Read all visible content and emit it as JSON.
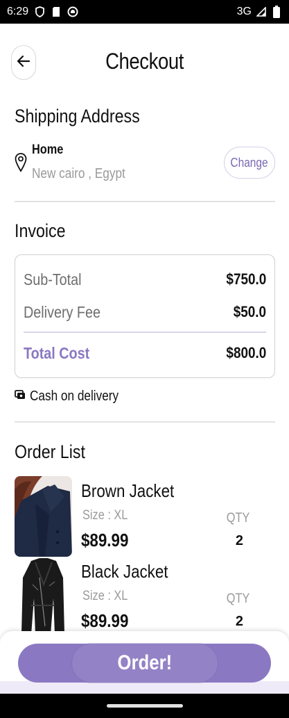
{
  "status_bar": {
    "time": "6:29",
    "network": "3G"
  },
  "header": {
    "title": "Checkout"
  },
  "shipping": {
    "section_title": "Shipping Address",
    "name": "Home",
    "address": "New cairo , Egypt",
    "change_label": "Change"
  },
  "invoice": {
    "section_title": "Invoice",
    "subtotal_label": "Sub-Total",
    "subtotal_value": "$750.0",
    "delivery_label": "Delivery Fee",
    "delivery_value": "$50.0",
    "total_label": "Total Cost",
    "total_value": "$800.0"
  },
  "payment": {
    "method": "Cash on delivery"
  },
  "order_list": {
    "section_title": "Order List",
    "qty_label": "QTY",
    "items": [
      {
        "name": "Brown Jacket",
        "size": "Size : XL",
        "price": "$89.99",
        "qty": "2"
      },
      {
        "name": "Black Jacket",
        "size": "Size : XL",
        "price": "$89.99",
        "qty": "2"
      }
    ]
  },
  "footer": {
    "order_button": "Order!"
  },
  "colors": {
    "accent": "#8b78c2",
    "muted_text": "#9a9a9a"
  }
}
